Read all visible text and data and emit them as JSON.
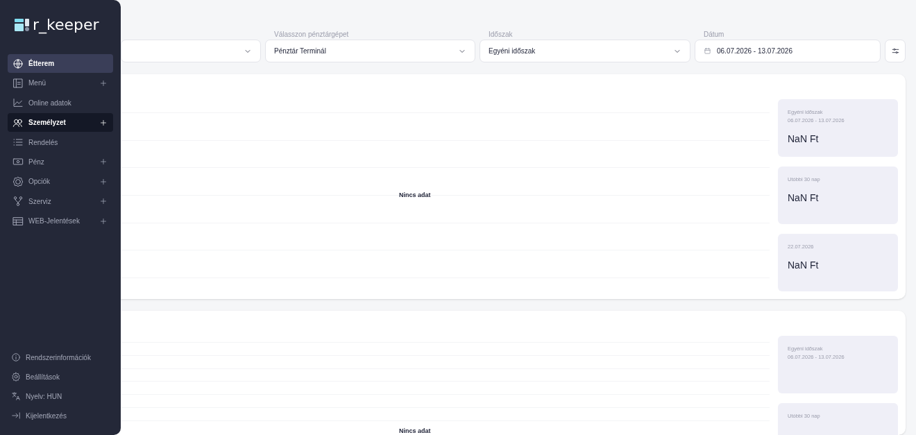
{
  "sidebar": {
    "logo": "r_keeper",
    "items": [
      {
        "label": "Étterem",
        "selected": true,
        "hovered": false,
        "expandable": false
      },
      {
        "label": "Menü",
        "selected": false,
        "hovered": false,
        "expandable": true
      },
      {
        "label": "Online adatok",
        "selected": false,
        "hovered": false,
        "expandable": false
      },
      {
        "label": "Személyzet",
        "selected": false,
        "hovered": true,
        "expandable": true
      },
      {
        "label": "Rendelés",
        "selected": false,
        "hovered": false,
        "expandable": false
      },
      {
        "label": "Pénz",
        "selected": false,
        "hovered": false,
        "expandable": true
      },
      {
        "label": "Opciók",
        "selected": false,
        "hovered": false,
        "expandable": true
      },
      {
        "label": "Szerviz",
        "selected": false,
        "hovered": false,
        "expandable": true
      },
      {
        "label": "WEB-Jelentések",
        "selected": false,
        "hovered": false,
        "expandable": true
      }
    ],
    "footer_items": [
      {
        "label": "Rendszerinformációk"
      },
      {
        "label": "Beállítások"
      },
      {
        "label": "Nyelv: HUN"
      },
      {
        "label": "Kijelentkezés"
      }
    ]
  },
  "filters": [
    {
      "kind": "select"
    },
    {
      "kind": "select",
      "label": "Válasszon pénztárgépet",
      "value": "Pénztár Terminál"
    },
    {
      "kind": "select",
      "label": "Időszak",
      "value": "Egyéni időszak"
    },
    {
      "kind": "date",
      "label": "Dátum",
      "value": "06.07.2026 - 13.07.2026"
    }
  ],
  "panels": [
    {
      "empty_text": "Nincs adat",
      "stats": [
        {
          "lines": [
            "Egyéni időszak",
            "06.07.2026 - 13.07.2026"
          ],
          "value": "NaN Ft"
        },
        {
          "lines": [
            "Utóbbi 30 nap"
          ],
          "value": "NaN Ft"
        },
        {
          "lines": [
            "22.07.2026"
          ],
          "value": "NaN Ft"
        }
      ]
    },
    {
      "empty_text": "Nincs adat",
      "stats": [
        {
          "lines": [
            "Egyéni időszak",
            "06.07.2026 - 13.07.2026"
          ]
        },
        {
          "lines": [
            "Utóbbi 30 nap"
          ]
        }
      ]
    }
  ]
}
